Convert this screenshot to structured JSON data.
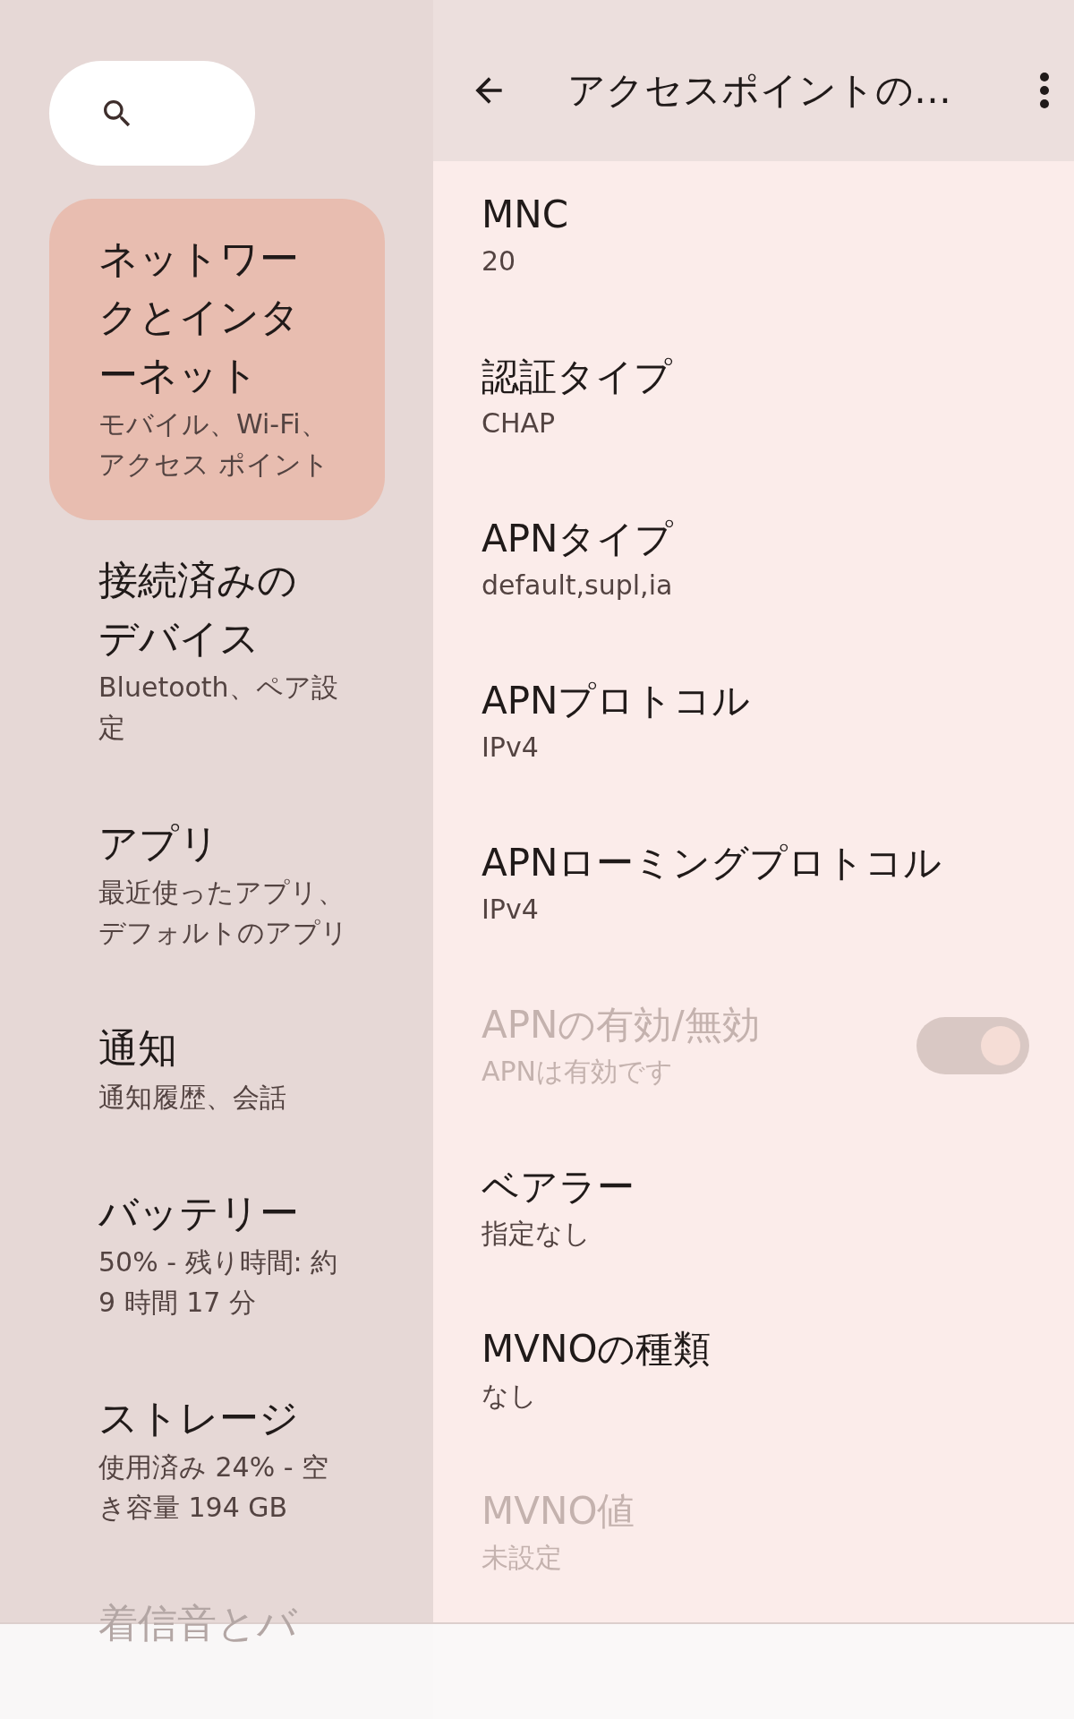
{
  "sidebar": {
    "items": [
      {
        "title": "ネットワークとインターネット",
        "subtitle": "モバイル、Wi-Fi、アクセス ポイント",
        "selected": true
      },
      {
        "title": "接続済みのデバイス",
        "subtitle": "Bluetooth、ペア設定",
        "selected": false
      },
      {
        "title": "アプリ",
        "subtitle": "最近使ったアプリ、デフォルトのアプリ",
        "selected": false
      },
      {
        "title": "通知",
        "subtitle": "通知履歴、会話",
        "selected": false
      },
      {
        "title": "バッテリー",
        "subtitle": "50% - 残り時間: 約 9 時間 17 分",
        "selected": false
      },
      {
        "title": "ストレージ",
        "subtitle": "使用済み 24% - 空き容量 194 GB",
        "selected": false
      },
      {
        "title": "着信音とバ",
        "selected": false
      }
    ]
  },
  "app_bar": {
    "title": "アクセスポイントの…"
  },
  "settings": [
    {
      "kind": "text",
      "title": "MNC",
      "value": "20",
      "disabled": false
    },
    {
      "kind": "text",
      "title": "認証タイプ",
      "value": "CHAP",
      "disabled": false
    },
    {
      "kind": "text",
      "title": "APNタイプ",
      "value": "default,supl,ia",
      "disabled": false
    },
    {
      "kind": "text",
      "title": "APNプロトコル",
      "value": "IPv4",
      "disabled": false
    },
    {
      "kind": "text",
      "title": "APNローミングプロトコル",
      "value": "IPv4",
      "disabled": false
    },
    {
      "kind": "switch",
      "title": "APNの有効/無効",
      "value": "APNは有効です",
      "disabled": true,
      "on": true
    },
    {
      "kind": "text",
      "title": "ベアラー",
      "value": "指定なし",
      "disabled": false
    },
    {
      "kind": "text",
      "title": "MVNOの種類",
      "value": "なし",
      "disabled": false
    },
    {
      "kind": "text",
      "title": "MVNO値",
      "value": "未設定",
      "disabled": true
    }
  ]
}
